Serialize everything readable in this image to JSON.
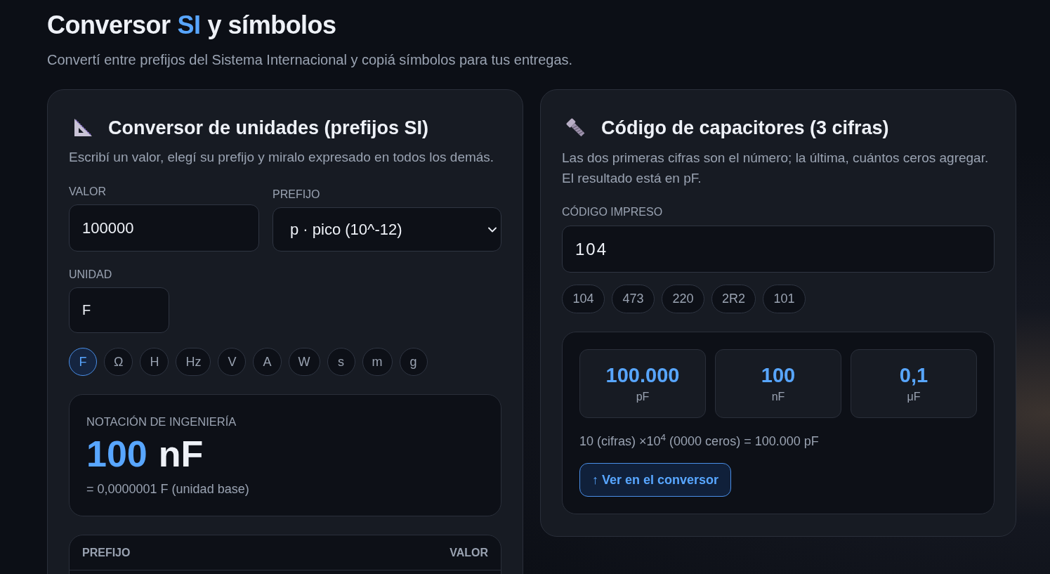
{
  "header": {
    "title_parts": [
      {
        "text": "Conversor",
        "highlighted": false
      },
      {
        "text": "SI",
        "highlighted": true
      },
      {
        "text": "y símbolos",
        "highlighted": false
      }
    ],
    "subtitle": "Convertí entre prefijos del Sistema Internacional y copiá símbolos para tus entregas."
  },
  "unit_converter": {
    "title": "Conversor de unidades (prefijos SI)",
    "description": "Escribí un valor, elegí su prefijo y miralo expresado en todos los demás.",
    "value_field": {
      "label": "VALOR",
      "value": "100000"
    },
    "prefix_select": {
      "label": "PREFIJO",
      "value": "p · pico (10^-12)"
    },
    "unit_field": {
      "label": "UNIDAD",
      "value": "F"
    },
    "unit_chips": [
      {
        "label": "F",
        "selected": true
      },
      {
        "label": "Ω",
        "selected": false
      },
      {
        "label": "H",
        "selected": false
      },
      {
        "label": "Hz",
        "selected": false
      },
      {
        "label": "V",
        "selected": false
      },
      {
        "label": "A",
        "selected": false
      },
      {
        "label": "W",
        "selected": false
      },
      {
        "label": "s",
        "selected": false
      },
      {
        "label": "m",
        "selected": false
      },
      {
        "label": "g",
        "selected": false
      }
    ],
    "engineering": {
      "label": "NOTACIÓN DE INGENIERÍA",
      "number": "100",
      "unit": "nF",
      "base_note": "= 0,0000001 F (unidad base)"
    },
    "prefix_table": {
      "columns": [
        "PREFIJO",
        "VALOR"
      ]
    }
  },
  "capacitor_code": {
    "title": "Código de capacitores (3 cifras)",
    "description": "Las dos primeras cifras son el número; la última, cuántos ceros agregar. El resultado está en pF.",
    "code_field": {
      "label": "CÓDIGO IMPRESO",
      "value": "104"
    },
    "examples": [
      "104",
      "473",
      "220",
      "2R2",
      "101"
    ],
    "results": [
      {
        "value": "100.000",
        "unit": "pF"
      },
      {
        "value": "100",
        "unit": "nF"
      },
      {
        "value": "0,1",
        "unit": "μF"
      }
    ],
    "formula": "10 (cifras) ×10$^{4}$ (0000 ceros) = 100.000 pF",
    "button": "↑ Ver en el conversor"
  }
}
